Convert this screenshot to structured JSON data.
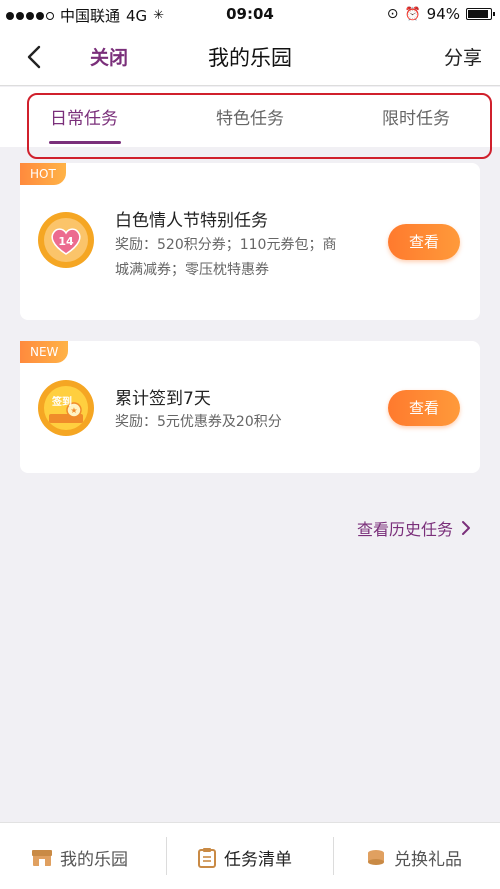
{
  "status_bar": {
    "carrier": "中国联通",
    "network": "4G",
    "time": "09:04",
    "battery": "94%"
  },
  "nav": {
    "close_label": "关闭",
    "title": "我的乐园",
    "share_label": "分享"
  },
  "tabs": [
    {
      "label": "日常任务",
      "active": true
    },
    {
      "label": "特色任务",
      "active": false
    },
    {
      "label": "限时任务",
      "active": false
    }
  ],
  "tasks": [
    {
      "badge": "HOT",
      "icon": "heart-14-icon",
      "icon_text": "14",
      "title": "白色情人节特别任务",
      "desc_line1": "奖励：520积分券；110元券包；商",
      "desc_line2": "城满减券；零压枕特惠券",
      "button": "查看"
    },
    {
      "badge": "NEW",
      "icon": "sign-in-icon",
      "icon_text": "签到",
      "title": "累计签到7天",
      "desc_line1": "奖励：5元优惠券及20积分",
      "button": "查看"
    }
  ],
  "history_link": "查看历史任务",
  "bottom_bar": {
    "items": [
      {
        "label": "我的乐园",
        "icon": "shop-icon"
      },
      {
        "label": "任务清单",
        "icon": "clipboard-icon"
      },
      {
        "label": "兑换礼品",
        "icon": "coins-icon"
      }
    ]
  },
  "colors": {
    "accent": "#7a2f7a",
    "button": "#ff8a34",
    "highlight_box": "#d0202c"
  }
}
